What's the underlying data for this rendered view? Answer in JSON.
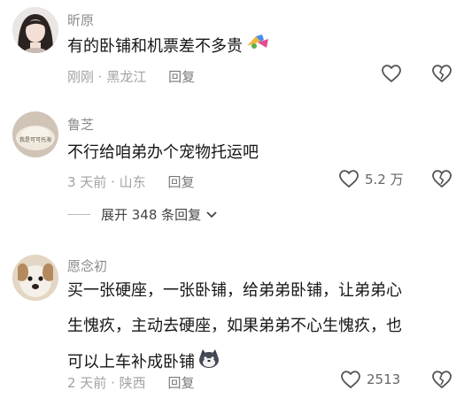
{
  "comments": [
    {
      "username": "昕原",
      "text": "有的卧铺和机票差不多贵",
      "time": "刚刚",
      "location": "黑龙江",
      "reply_label": "回复",
      "likes": ""
    },
    {
      "username": "鲁芝",
      "avatar_caption": "我是可可托海",
      "text": "不行给咱弟办个宠物托运吧",
      "time": "3 天前",
      "location": "山东",
      "reply_label": "回复",
      "likes": "5.2 万",
      "expand_label": "展开 348 条回复"
    },
    {
      "username": "愿念初",
      "text_lines": [
        "买一张硬座，一张卧铺，给弟弟卧铺，让弟弟心",
        "生愧疚，主动去硬座，如果弟弟不心生愧疚，也",
        "可以上车补成卧铺"
      ],
      "time": "2 天前",
      "location": "陕西",
      "reply_label": "回复",
      "likes": "2513"
    }
  ],
  "meta_separator": "·",
  "icons": [
    "heart-icon",
    "broken-heart-icon",
    "chevron-down-icon",
    "emoji-icon"
  ],
  "colors": {
    "text": "#161616",
    "username": "#8a8a8a",
    "meta": "#a3a3a3"
  }
}
